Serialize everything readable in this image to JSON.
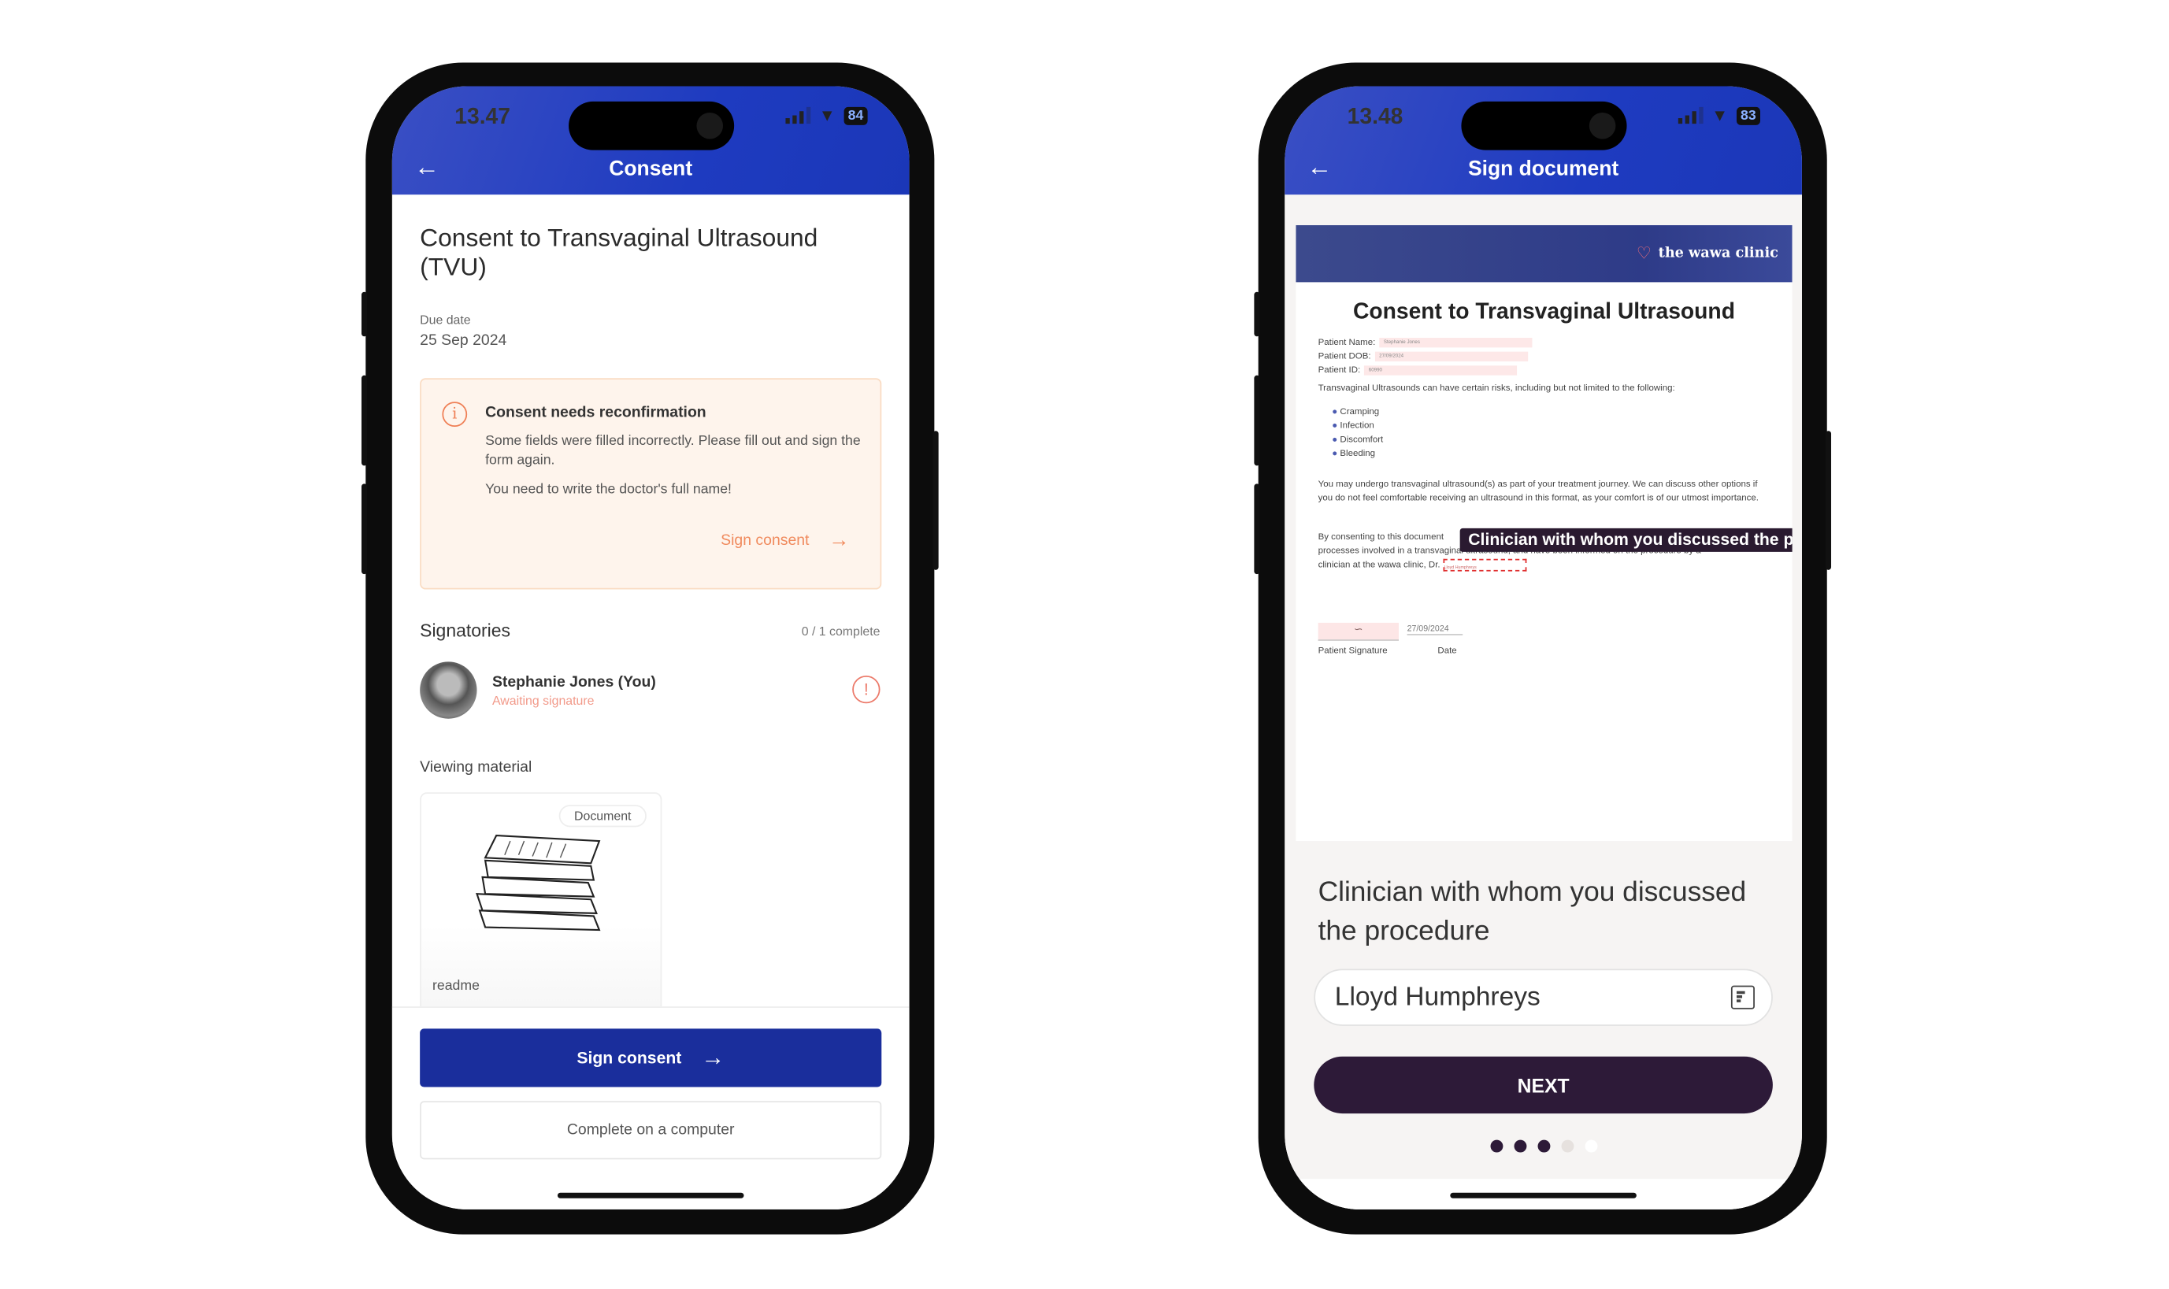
{
  "left_phone": {
    "status": {
      "time": "13.47",
      "battery": "84"
    },
    "header": {
      "title": "Consent",
      "back_icon": "arrow-left-icon"
    },
    "title": "Consent to Transvaginal Ultrasound (TVU)",
    "due_date_label": "Due date",
    "due_date": "25 Sep 2024",
    "alert": {
      "icon": "info-circle-icon",
      "title": "Consent needs reconfirmation",
      "body": "Some fields were filled incorrectly. Please fill out and sign the form again.",
      "note": "You need to write the doctor's full name!",
      "link": "Sign consent"
    },
    "signatories": {
      "heading": "Signatories",
      "progress": "0 / 1 complete",
      "items": [
        {
          "name": "Stephanie Jones (You)",
          "status": "Awaiting signature",
          "icon": "warning-circle-icon"
        }
      ]
    },
    "viewing_material": {
      "heading": "Viewing material",
      "items": [
        {
          "tag": "Document",
          "name": "readme"
        }
      ]
    },
    "buttons": {
      "sign_consent": "Sign consent",
      "complete_on_computer": "Complete on a computer"
    }
  },
  "right_phone": {
    "status": {
      "time": "13.48",
      "battery": "83"
    },
    "header": {
      "title": "Sign document",
      "back_icon": "arrow-left-icon"
    },
    "document": {
      "clinic_logo": "the wawa clinic",
      "title": "Consent to Transvaginal Ultrasound",
      "fields": [
        {
          "label": "Patient Name:",
          "value": "Stephanie Jones"
        },
        {
          "label": "Patient DOB:",
          "value": "27/09/2024"
        },
        {
          "label": "Patient ID:",
          "value": "60990"
        }
      ],
      "intro": "Transvaginal Ultrasounds can have certain risks, including but not limited to the following:",
      "risks": [
        "Cramping",
        "Infection",
        "Discomfort",
        "Bleeding"
      ],
      "para1": "You may undergo transvaginal ultrasound(s) as part of your treatment journey. We can discuss other options if you do not feel comfortable receiving an ultrasound in this format, as your comfort is of our utmost importance.",
      "para2_start": "By consenting to this document",
      "para2_line2": "processes involved in a transvaginal ultrasound, and have been informed on the procedure by a",
      "para2_line3": "clinician at the wawa clinic, Dr.",
      "doctor_field_value": "Lloyd Humphreys",
      "tooltip": "Clinician with whom you discussed the procedure",
      "signature_date": "27/09/2024",
      "signature_label": "Patient Signature",
      "date_label": "Date"
    },
    "question": "Clinician with whom you discussed the procedure",
    "input_value": "Lloyd Humphreys",
    "input_icon": "document-icon",
    "next_button": "NEXT",
    "steps": {
      "current": 3,
      "total": 5
    },
    "colors": {
      "primary_dark": "#2d1a38",
      "error": "#e03030"
    }
  },
  "colors": {
    "header_blue": "#1e3bc0",
    "button_blue": "#1a2e9c",
    "alert_orange": "#f08a5d"
  }
}
